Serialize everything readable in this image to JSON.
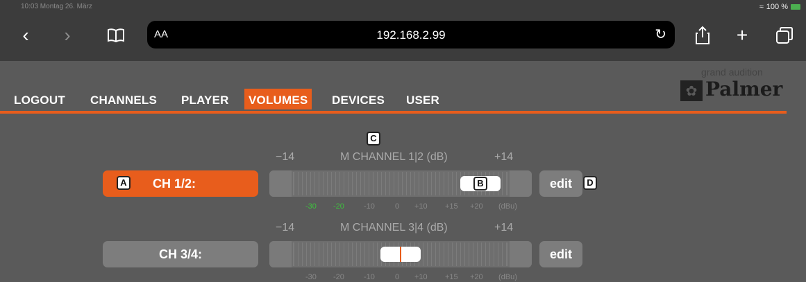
{
  "status": {
    "left": "10:03   Montag 26. März",
    "battery": "100 %"
  },
  "browser": {
    "aa": "AA",
    "url": "192.168.2.99",
    "icons": [
      "back-icon",
      "forward-icon",
      "bookmarks-icon",
      "reload-icon",
      "share-icon",
      "new-tab-icon",
      "tabs-icon"
    ]
  },
  "nav": {
    "items": [
      "LOGOUT",
      "CHANNELS",
      "PLAYER",
      "VOLUMES",
      "DEVICES",
      "USER"
    ],
    "active": "VOLUMES"
  },
  "brand": {
    "tagline": "grand audition",
    "name": "Palmer"
  },
  "markers": {
    "a": "A",
    "b": "B",
    "c": "C",
    "d": "D"
  },
  "colors": {
    "accent": "#e85d1c",
    "meter_green": "#3ec23e"
  },
  "channels": [
    {
      "label": "CH 1/2:",
      "header": "M CHANNEL 1|2 (dB)",
      "scale_min": "−14",
      "scale_max": "+14",
      "scale_bottom": [
        "-30",
        "-20",
        "-10",
        "0",
        "+10",
        "+15",
        "+20",
        "(dBu)"
      ],
      "edit_label": "edit",
      "fader_level": 0.87
    },
    {
      "label": "CH 3/4:",
      "header": "M CHANNEL 3|4 (dB)",
      "scale_min": "−14",
      "scale_max": "+14",
      "scale_bottom": [
        "-30",
        "-20",
        "-10",
        "0",
        "+10",
        "+15",
        "+20",
        "(dBu)"
      ],
      "edit_label": "edit",
      "fader_level": 0.5
    }
  ]
}
